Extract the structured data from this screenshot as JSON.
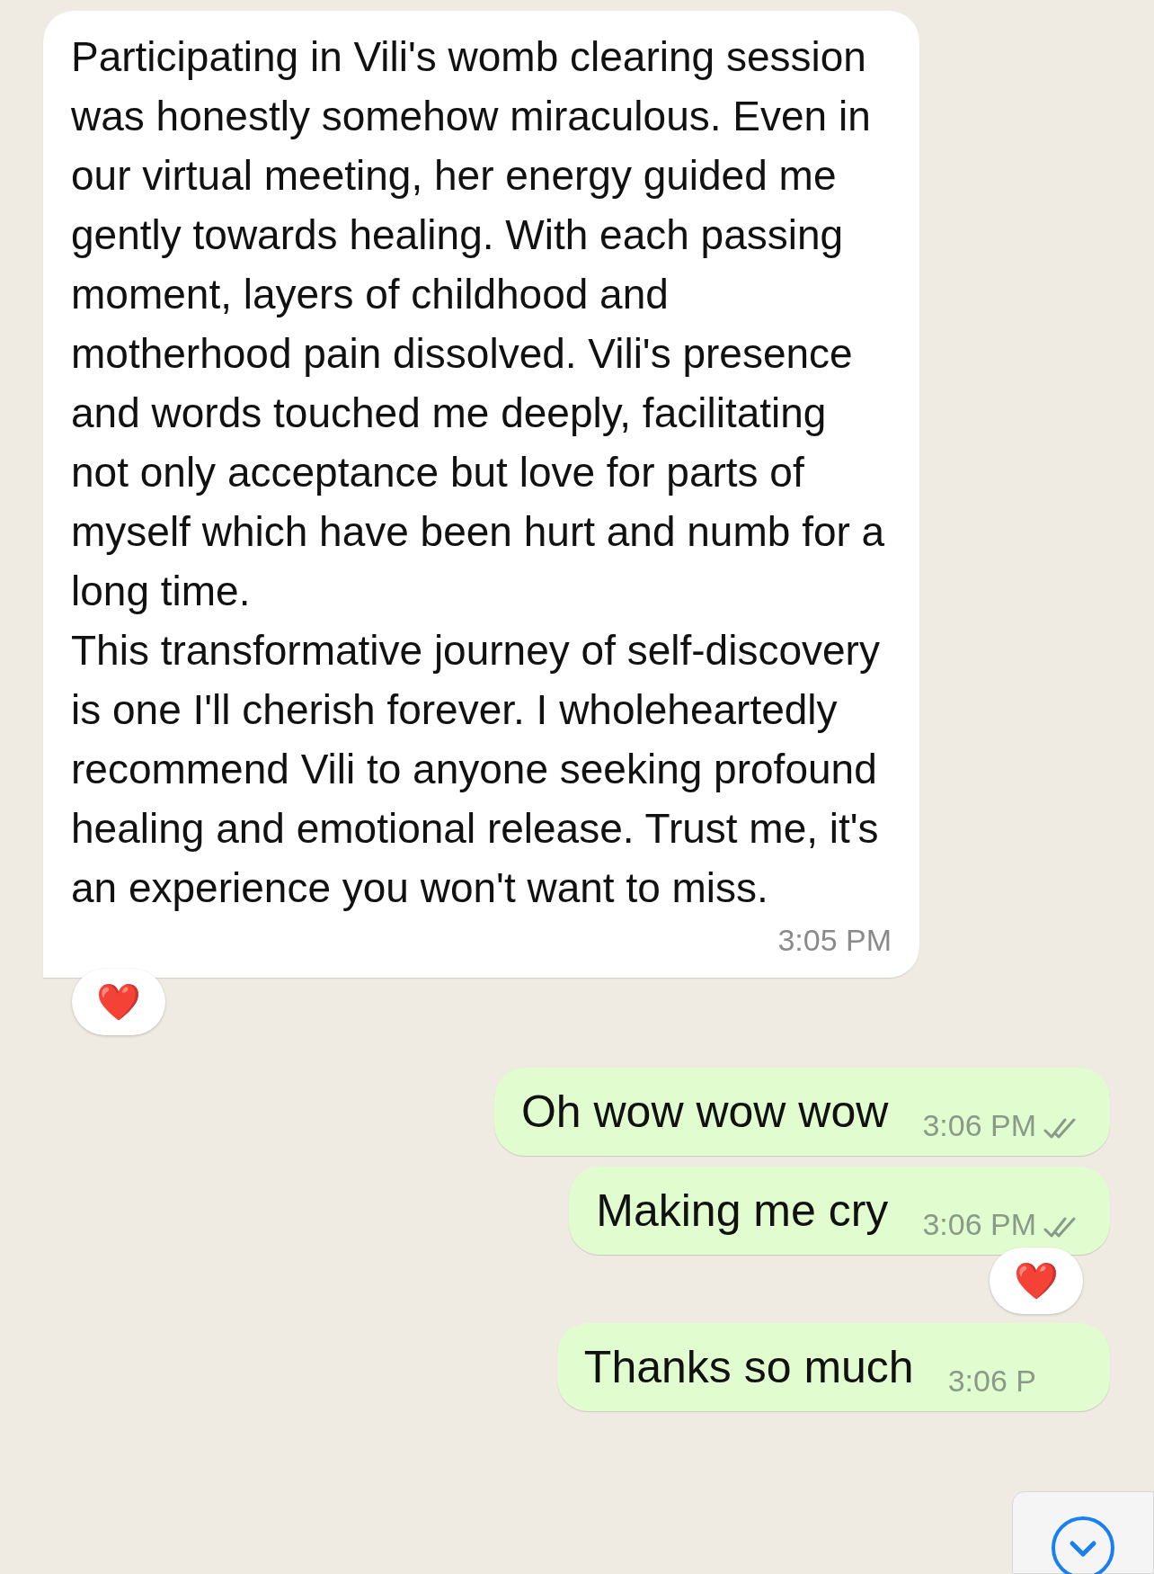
{
  "messages": [
    {
      "kind": "incoming",
      "paragraphs": [
        "Participating in Vili's womb clearing session was honestly somehow miraculous. Even in our virtual meeting, her energy guided me gently towards healing. With each passing moment, layers of childhood and motherhood pain dissolved. Vili's presence and words touched me deeply, facilitating not only acceptance but love for parts of myself which have been hurt and numb for a long time.",
        "This transformative journey of self-discovery is one I'll cherish forever. I wholeheartedly recommend Vili to anyone seeking profound healing and emotional release. Trust me, it's an experience you won't want to miss."
      ],
      "time": "3:05 PM",
      "reaction": "❤️"
    },
    {
      "kind": "outgoing",
      "paragraphs": [
        "Oh wow wow wow"
      ],
      "time": "3:06 PM",
      "read": false
    },
    {
      "kind": "outgoing",
      "paragraphs": [
        "Making me cry"
      ],
      "time": "3:06 PM",
      "read": false,
      "reaction": "❤️"
    },
    {
      "kind": "outgoing",
      "paragraphs": [
        "Thanks so much"
      ],
      "time": "3:06 P"
    }
  ]
}
